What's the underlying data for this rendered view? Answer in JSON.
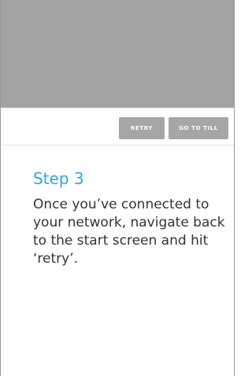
{
  "preview": {},
  "toolbar": {
    "retry_label": "RETRY",
    "go_to_till_label": "GO TO TILL"
  },
  "step": {
    "title": "Step 3",
    "description": "Once you’ve connected to your network, navigate back to the start screen and hit ‘retry’."
  },
  "colors": {
    "accent": "#2ea6dc",
    "preview_gray": "#a3a3a3",
    "button_gray": "#a6a6a6",
    "text_dark": "#333333"
  }
}
